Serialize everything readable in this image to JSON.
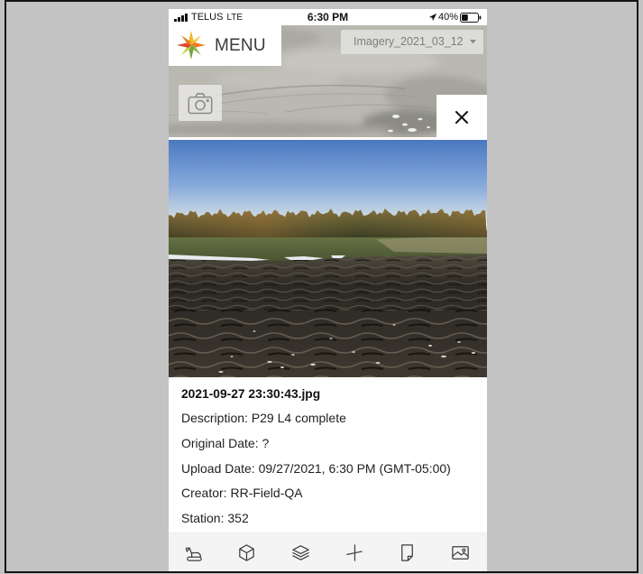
{
  "status_bar": {
    "carrier": "TELUS",
    "network": "LTE",
    "time": "6:30 PM",
    "battery_percent": "40%",
    "battery_level": 0.4,
    "icons": [
      "signal-bars-icon",
      "location-arrow-icon",
      "battery-icon"
    ]
  },
  "header": {
    "menu_label": "MENU",
    "logo_icon": "compass-star-logo"
  },
  "imagery_select": {
    "selected": "Imagery_2021_03_12",
    "icon": "chevron-down-icon"
  },
  "map_controls": {
    "camera_icon": "camera-icon",
    "close_icon": "close-icon"
  },
  "photo_info": {
    "filename": "2021-09-27 23:30:43.jpg",
    "fields": [
      {
        "label": "Description:",
        "value": "P29 L4 complete"
      },
      {
        "label": "Original Date:",
        "value": "?"
      },
      {
        "label": "Upload Date:",
        "value": "09/27/2021, 6:30 PM (GMT-05:00)"
      },
      {
        "label": "Creator:",
        "value": "RR-Field-QA"
      },
      {
        "label": "Station:",
        "value": "352"
      }
    ]
  },
  "toolbar": {
    "items": [
      {
        "icon": "excavator-icon"
      },
      {
        "icon": "cube-icon"
      },
      {
        "icon": "layers-icon"
      },
      {
        "icon": "axis-icon"
      },
      {
        "icon": "note-icon"
      },
      {
        "icon": "image-icon"
      }
    ]
  },
  "colors": {
    "page_background": "#c3c3c3",
    "panel": "#ffffff",
    "toolbar": "#f4f4f4",
    "text": "#1f1f1f",
    "logo": [
      "#f0b429",
      "#f5c84a",
      "#ee7b22",
      "#8bb84f",
      "#74a341",
      "#c9d04a",
      "#dc4a2b",
      "#ee7b22"
    ]
  }
}
